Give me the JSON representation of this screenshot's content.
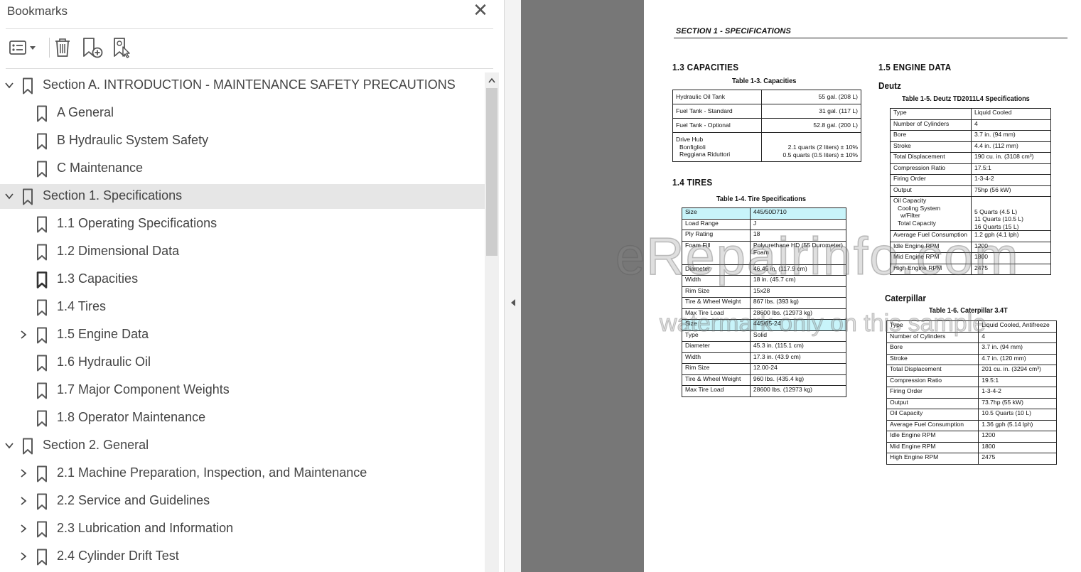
{
  "panel": {
    "title": "Bookmarks",
    "close_glyph": "✕",
    "toolbar": [
      {
        "name": "options-menu-icon"
      },
      {
        "name": "delete-icon"
      },
      {
        "name": "new-bookmark-icon"
      },
      {
        "name": "find-bookmark-icon"
      }
    ],
    "bookmarks": [
      {
        "label": "Section A. INTRODUCTION - MAINTENANCE SAFETY PRECAUTIONS",
        "level": 0,
        "chevron": "expanded"
      },
      {
        "label": "A General",
        "level": 1,
        "chevron": "none"
      },
      {
        "label": "B Hydraulic System Safety",
        "level": 1,
        "chevron": "none"
      },
      {
        "label": "C Maintenance",
        "level": 1,
        "chevron": "none"
      },
      {
        "label": "Section 1. Specifications",
        "level": 0,
        "chevron": "expanded",
        "selected": true
      },
      {
        "label": "1.1 Operating Specifications",
        "level": 1,
        "chevron": "none"
      },
      {
        "label": "1.2 Dimensional Data",
        "level": 1,
        "chevron": "none"
      },
      {
        "label": "1.3 Capacities",
        "level": 1,
        "chevron": "none",
        "current": true
      },
      {
        "label": "1.4 Tires",
        "level": 1,
        "chevron": "none"
      },
      {
        "label": "1.5 Engine Data",
        "level": 1,
        "chevron": "collapsed"
      },
      {
        "label": "1.6 Hydraulic Oil",
        "level": 1,
        "chevron": "none"
      },
      {
        "label": "1.7 Major Component Weights",
        "level": 1,
        "chevron": "none"
      },
      {
        "label": "1.8 Operator Maintenance",
        "level": 1,
        "chevron": "none"
      },
      {
        "label": "Section 2. General",
        "level": 0,
        "chevron": "expanded"
      },
      {
        "label": "2.1 Machine Preparation, Inspection, and Maintenance",
        "level": 1,
        "chevron": "collapsed"
      },
      {
        "label": "2.2 Service and Guidelines",
        "level": 1,
        "chevron": "collapsed"
      },
      {
        "label": "2.3 Lubrication and Information",
        "level": 1,
        "chevron": "collapsed"
      },
      {
        "label": "2.4 Cylinder Drift Test",
        "level": 1,
        "chevron": "collapsed"
      }
    ]
  },
  "document": {
    "section_title": "SECTION 1 - SPECIFICATIONS",
    "capacities": {
      "heading": "1.3  CAPACITIES",
      "caption": "Table 1-3. Capacities",
      "rows": [
        {
          "label": "Hydraulic Oil Tank",
          "value": "55 gal. (208 L)"
        },
        {
          "label": "Fuel Tank - Standard",
          "value": "31 gal. (117 L)"
        },
        {
          "label": "Fuel Tank - Optional",
          "value": "52.8 gal. (200 L)"
        }
      ],
      "drive_hub": {
        "label": "Drive Hub",
        "sub1": "Bonfiglioli",
        "sub2": "Reggiana Riduttori",
        "val1": "2.1 quarts (2 liters) ± 10%",
        "val2": "0.5 quarts (0.5 liters) ± 10%"
      }
    },
    "tires": {
      "heading": "1.4  TIRES",
      "caption": "Table 1-4. Tire Specifications",
      "rows": [
        {
          "label": "Size",
          "value": "445/50D710",
          "highlight": true
        },
        {
          "label": "Load Range",
          "value": "J"
        },
        {
          "label": "Ply Rating",
          "value": "18"
        },
        {
          "label": "Foam Fill",
          "value": "Polyurethane HD (55 Durometer)",
          "value2": "Foam"
        },
        {
          "label": "Diameter",
          "value": "46.45 in. (117.9 cm)"
        },
        {
          "label": "Width",
          "value": "18 in. (45.7 cm)"
        },
        {
          "label": "Rim Size",
          "value": "15x28"
        },
        {
          "label": "Tire & Wheel Weight",
          "value": "867 lbs. (393 kg)"
        },
        {
          "label": "Max Tire Load",
          "value": "28600 lbs. (12973 kg)"
        },
        {
          "label": "Size",
          "value": "445/65-24",
          "highlight": true
        },
        {
          "label": "Type",
          "value": "Solid"
        },
        {
          "label": "Diameter",
          "value": "45.3 in. (115.1 cm)"
        },
        {
          "label": "Width",
          "value": "17.3 in. (43.9 cm)"
        },
        {
          "label": "Rim Size",
          "value": "12.00-24"
        },
        {
          "label": "Tire & Wheel Weight",
          "value": "960 lbs. (435.4 kg)"
        },
        {
          "label": "Max Tire Load",
          "value": "28600 lbs. (12973 kg)"
        }
      ]
    },
    "engine": {
      "heading": "1.5  ENGINE DATA",
      "deutz": {
        "subheading": "Deutz",
        "caption": "Table 1-5. Deutz TD2011L4 Specifications",
        "rows": [
          {
            "label": "Type",
            "value": "Liquid Cooled"
          },
          {
            "label": "Number of Cylinders",
            "value": "4"
          },
          {
            "label": "Bore",
            "value": "3.7 in. (94 mm)"
          },
          {
            "label": "Stroke",
            "value": "4.4 in. (112 mm)"
          },
          {
            "label": "Total Displacement",
            "value": "190 cu. in. (3108 cm³)"
          },
          {
            "label": "Compression Ratio",
            "value": "17.5:1"
          },
          {
            "label": "Firing Order",
            "value": "1-3-4-2"
          },
          {
            "label": "Output",
            "value": "75hp (56 kW)"
          }
        ],
        "oil": {
          "label": "Oil Capacity",
          "sub1": "Cooling System",
          "sub2": "w/Filter",
          "sub3": "Total Capacity",
          "val1": "5 Quarts (4.5 L)",
          "val2": "11 Quarts (10.5 L)",
          "val3": "16 Quarts (15 L)"
        },
        "rows2": [
          {
            "label": "Average Fuel Consumption",
            "value": "1.2 gph (4.1 lph)"
          },
          {
            "label": "Idle Engine RPM",
            "value": "1200"
          },
          {
            "label": "Mid Engine RPM",
            "value": "1800"
          },
          {
            "label": "High Engine RPM",
            "value": "2475"
          }
        ]
      },
      "caterpillar": {
        "subheading": "Caterpillar",
        "caption": "Table 1-6. Caterpillar 3.4T",
        "rows": [
          {
            "label": "Type",
            "value": "Liquid Cooled, Antifreeze"
          },
          {
            "label": "Number of Cylinders",
            "value": "4"
          },
          {
            "label": "Bore",
            "value": "3.7 in. (94 mm)"
          },
          {
            "label": "Stroke",
            "value": "4.7 in. (120 mm)"
          },
          {
            "label": "Total Displacement",
            "value": "201 cu. in. (3294 cm³)"
          },
          {
            "label": "Compression Ratio",
            "value": "19.5:1"
          },
          {
            "label": "Firing Order",
            "value": "1-3-4-2"
          },
          {
            "label": "Output",
            "value": "73.7hp (55 kW)"
          },
          {
            "label": "Oil Capacity",
            "value": "10.5 Quarts (10 L)"
          },
          {
            "label": "Average Fuel Consumption",
            "value": "1.36 gph (5.14 lph)"
          },
          {
            "label": "Idle Engine RPM",
            "value": "1200"
          },
          {
            "label": "Mid Engine RPM",
            "value": "1800"
          },
          {
            "label": "High Engine RPM",
            "value": "2475"
          }
        ]
      }
    },
    "watermark": {
      "line1": "eRepairinfo.com",
      "line2": "watermark only on this sample"
    }
  }
}
